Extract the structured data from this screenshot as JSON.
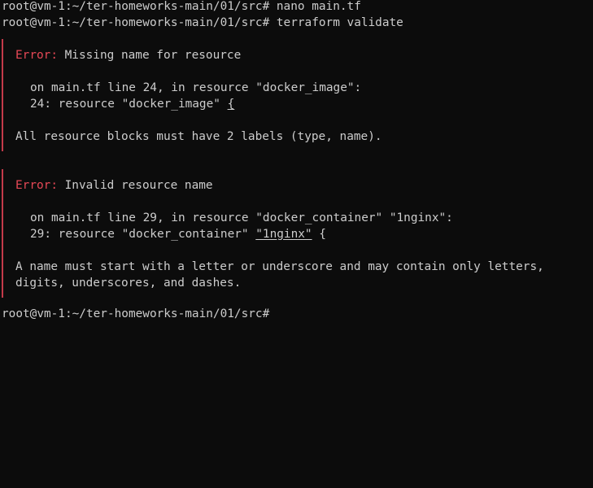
{
  "terminal": {
    "lines": [
      "root@vm-1:~/ter-homeworks-main/01/src# nano main.tf",
      "root@vm-1:~/ter-homeworks-main/01/src# terraform validate"
    ],
    "final_prompt": "root@vm-1:~/ter-homeworks-main/01/src#"
  },
  "errors": [
    {
      "label": "Error:",
      "summary": " Missing name for resource",
      "location": "on main.tf line 24, in resource \"docker_image\":",
      "code_prefix": "24: resource \"docker_image\" ",
      "code_highlight": "{",
      "code_suffix": "",
      "detail": [
        "All resource blocks must have 2 labels (type, name)."
      ]
    },
    {
      "label": "Error:",
      "summary": " Invalid resource name",
      "location": "on main.tf line 29, in resource \"docker_container\" \"1nginx\":",
      "code_prefix": "29: resource \"docker_container\" ",
      "code_highlight": "\"1nginx\"",
      "code_suffix": " {",
      "detail": [
        "A name must start with a letter or underscore and may contain only letters,",
        "digits, underscores, and dashes."
      ]
    }
  ],
  "colors": {
    "background": "#0c0c0c",
    "text": "#cccccc",
    "error_label": "#e74856",
    "error_bar": "#c43a4a"
  }
}
